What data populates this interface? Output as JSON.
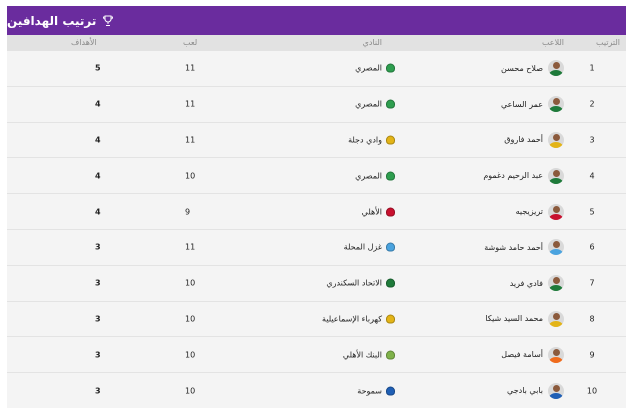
{
  "header": {
    "title": "ترتيب الهدافين",
    "icon": "trophy-icon"
  },
  "columns": {
    "rank": "الترتيب",
    "player": "اللاعب",
    "club": "النادي",
    "played": "لعب",
    "goals": "الأهداف"
  },
  "rows": [
    {
      "rank": "1",
      "player": "صلاح محسن",
      "club": "المصري",
      "played": "11",
      "goals": "5",
      "avatar_color": "#1e7a3a",
      "badge_color": "#2e9e4f"
    },
    {
      "rank": "2",
      "player": "عمر الساعي",
      "club": "المصري",
      "played": "11",
      "goals": "4",
      "avatar_color": "#1e7a3a",
      "badge_color": "#2e9e4f"
    },
    {
      "rank": "3",
      "player": "أحمد فاروق",
      "club": "وادي دجلة",
      "played": "11",
      "goals": "4",
      "avatar_color": "#e3b417",
      "badge_color": "#e3b417"
    },
    {
      "rank": "4",
      "player": "عبد الرحيم دغموم",
      "club": "المصري",
      "played": "10",
      "goals": "4",
      "avatar_color": "#1e7a3a",
      "badge_color": "#2e9e4f"
    },
    {
      "rank": "5",
      "player": "تريزيجيه",
      "club": "الأهلي",
      "played": "9",
      "goals": "4",
      "avatar_color": "#c8102e",
      "badge_color": "#c8102e"
    },
    {
      "rank": "6",
      "player": "أحمد حامد شوشة",
      "club": "غزل المحلة",
      "played": "11",
      "goals": "3",
      "avatar_color": "#4aa3df",
      "badge_color": "#4aa3df"
    },
    {
      "rank": "7",
      "player": "فادي فريد",
      "club": "الاتحاد السكندري",
      "played": "10",
      "goals": "3",
      "avatar_color": "#1e7a3a",
      "badge_color": "#1e7a3a"
    },
    {
      "rank": "8",
      "player": "محمد السيد شيكا",
      "club": "كهرباء الإسماعيلية",
      "played": "10",
      "goals": "3",
      "avatar_color": "#e3b417",
      "badge_color": "#e3b417"
    },
    {
      "rank": "9",
      "player": "أسامة فيصل",
      "club": "البنك الأهلي",
      "played": "10",
      "goals": "3",
      "avatar_color": "#f06b1c",
      "badge_color": "#7fb24a"
    },
    {
      "rank": "10",
      "player": "بابي بادجي",
      "club": "سموحة",
      "played": "10",
      "goals": "3",
      "avatar_color": "#1f5fb5",
      "badge_color": "#1f5fb5"
    }
  ]
}
